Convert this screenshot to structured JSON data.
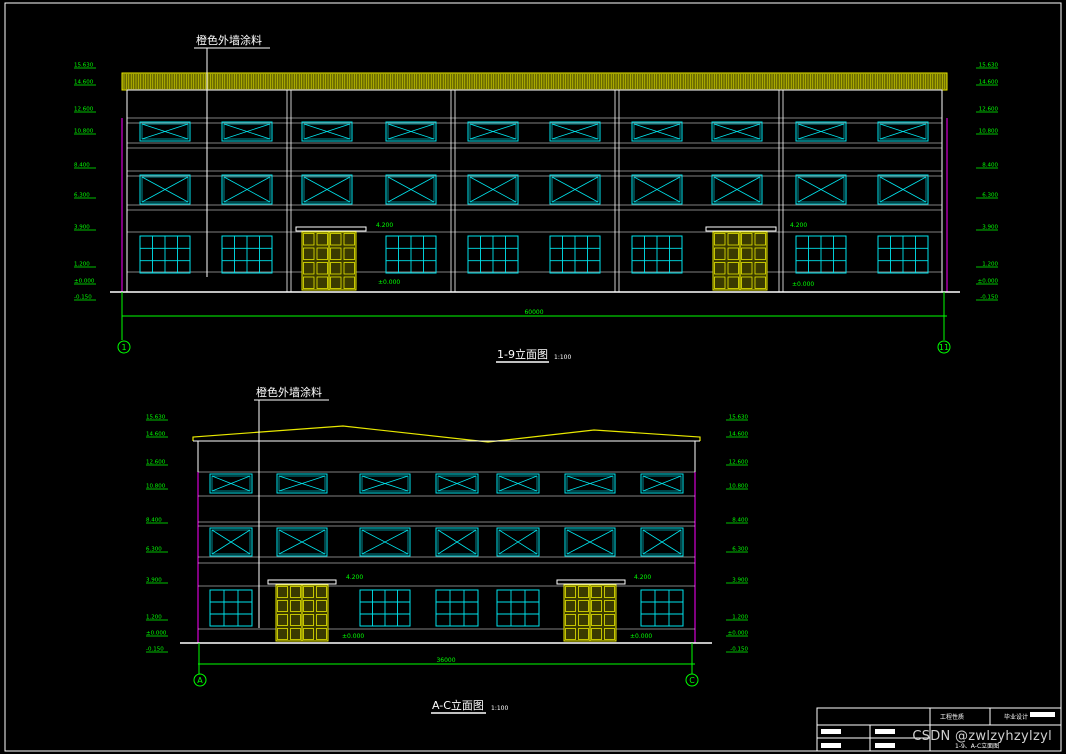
{
  "callout_label": "橙色外墙涂料",
  "top_elevation": {
    "title": "1-9立面图",
    "scale": "1:100",
    "dimension": "60000",
    "axis_left": "1",
    "axis_right": "11",
    "left_levels": [
      "15.630",
      "14.600",
      "12.600",
      "10.800",
      "8.400",
      "6.300",
      "3.900",
      "1.200",
      "±0.000",
      "-0.150"
    ],
    "right_levels": [
      "15.630",
      "14.600",
      "12.600",
      "10.800",
      "8.400",
      "6.300",
      "3.900",
      "1.200",
      "±0.000",
      "-0.150"
    ],
    "canopy_labels": [
      "4.200",
      "4.200"
    ],
    "door_labels": [
      "±0.000",
      "±0.000"
    ]
  },
  "side_elevation": {
    "title": "A-C立面图",
    "scale": "1:100",
    "dimension": "36000",
    "axis_left": "A",
    "axis_right": "C",
    "left_levels": [
      "15.630",
      "14.600",
      "12.600",
      "10.800",
      "8.400",
      "6.300",
      "3.900",
      "1.200",
      "±0.000",
      "-0.150"
    ],
    "right_levels": [
      "15.630",
      "14.600",
      "12.600",
      "10.800",
      "8.400",
      "6.300",
      "3.900",
      "1.200",
      "±0.000",
      "-0.150"
    ],
    "canopy_labels": [
      "4.200",
      "4.200"
    ],
    "door_labels": [
      "±0.000",
      "±0.000"
    ]
  },
  "title_block": {
    "project": "工程性质",
    "design": "毕业设计",
    "drawing_name": "1-9、A-C立面图"
  },
  "watermark": "CSDN @zwlzyhzylzyl",
  "colors": {
    "background": "#000000",
    "lines": "#ffffff",
    "windows": "#00e5ee",
    "roof": "#e8e800",
    "doors": "#e8e800",
    "levels": "#00ff00",
    "edges": "#ff00ff"
  }
}
